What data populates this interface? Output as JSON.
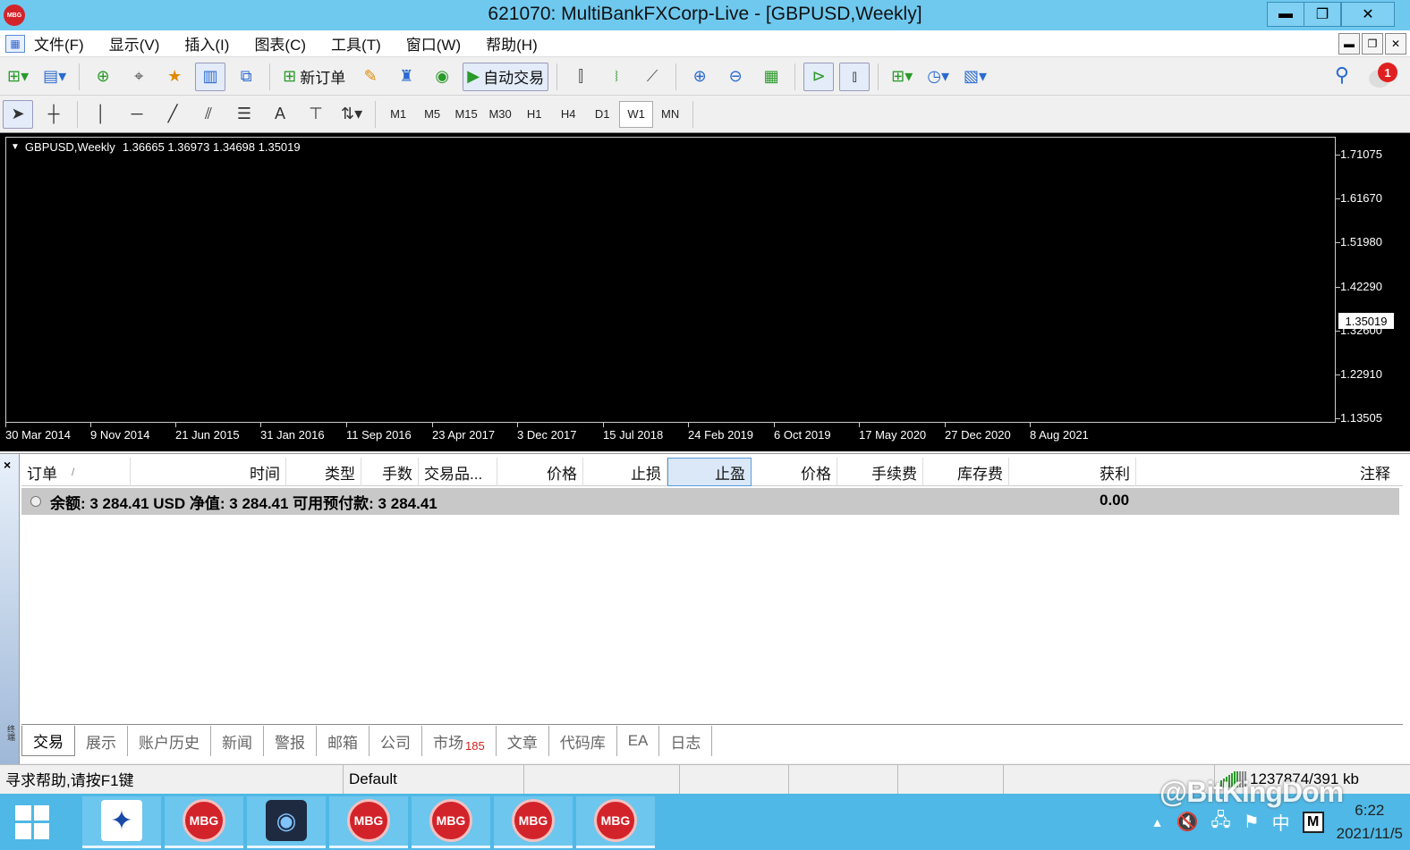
{
  "window": {
    "title": "621070: MultiBankFXCorp-Live - [GBPUSD,Weekly]",
    "logo": "MBG",
    "minimize": "▬",
    "restore": "❐",
    "close": "✕"
  },
  "menu": {
    "items": [
      "文件(F)",
      "显示(V)",
      "插入(I)",
      "图表(C)",
      "工具(T)",
      "窗口(W)",
      "帮助(H)"
    ],
    "mdi": [
      "▬",
      "❐",
      "✕"
    ]
  },
  "toolbar1": {
    "new_order": "新订单",
    "auto_trading": "自动交易",
    "notification_count": "1"
  },
  "toolbar2": {
    "text_tool": "A",
    "timeframes": [
      "M1",
      "M5",
      "M15",
      "M30",
      "H1",
      "H4",
      "D1",
      "W1",
      "MN"
    ],
    "active_timeframe": "W1"
  },
  "chart": {
    "symbol": "GBPUSD,Weekly",
    "ohlc": "1.36665 1.36973 1.34698 1.35019",
    "current_price": "1.35019",
    "y_ticks": [
      "1.71075",
      "1.61670",
      "1.51980",
      "1.42290",
      "1.32600",
      "1.22910",
      "1.13505"
    ],
    "x_ticks": [
      "30 Mar 2014",
      "9 Nov 2014",
      "21 Jun 2015",
      "31 Jan 2016",
      "11 Sep 2016",
      "23 Apr 2017",
      "3 Dec 2017",
      "15 Jul 2018",
      "24 Feb 2019",
      "6 Oct 2019",
      "17 May 2020",
      "27 Dec 2020",
      "8 Aug 2021"
    ]
  },
  "terminal": {
    "close": "×",
    "grip": "终端",
    "columns": {
      "order": "订单",
      "sort": "/",
      "time": "时间",
      "type": "类型",
      "lots": "手数",
      "symbol": "交易品...",
      "price": "价格",
      "sl": "止损",
      "tp": "止盈",
      "price2": "价格",
      "commission": "手续费",
      "swap": "库存费",
      "profit": "获利",
      "comment": "注释"
    },
    "balance_text": "余额: 3 284.41 USD  净值: 3 284.41  可用预付款: 3 284.41",
    "balance_profit": "0.00",
    "tabs": [
      "交易",
      "展示",
      "账户历史",
      "新闻",
      "警报",
      "邮箱",
      "公司",
      "市场",
      "文章",
      "代码库",
      "EA",
      "日志"
    ],
    "market_badge": "185"
  },
  "status": {
    "help": "寻求帮助,请按F1键",
    "profile": "Default",
    "traffic": "1237874/391 kb"
  },
  "taskbar": {
    "mbg_label": "MBG",
    "clock_time": "6:22",
    "clock_date": "2021/11/5",
    "ime": "中",
    "m_icon": "M",
    "watermark": "@BitKingDom"
  }
}
